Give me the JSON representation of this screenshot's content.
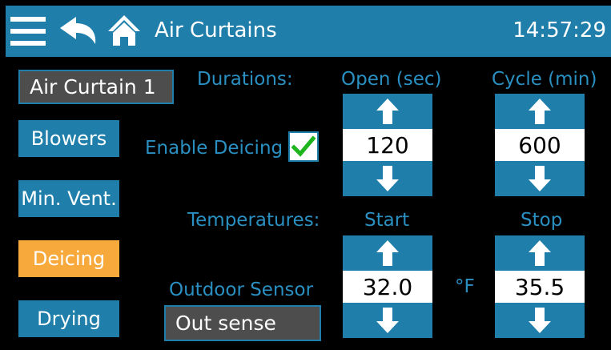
{
  "header": {
    "title": "Air Curtains",
    "time": "14:57:29",
    "icons": [
      "menu-icon",
      "back-arrow-icon",
      "home-icon"
    ]
  },
  "curtain_select": {
    "value": "Air Curtain 1"
  },
  "sidebar": {
    "items": [
      {
        "label": "Blowers",
        "active": false
      },
      {
        "label": "Min. Vent.",
        "active": false
      },
      {
        "label": "Deicing",
        "active": true
      },
      {
        "label": "Drying",
        "active": false
      }
    ]
  },
  "durations": {
    "label": "Durations:",
    "enable_label": "Enable Deicing",
    "enabled": true,
    "open": {
      "header": "Open (sec)",
      "value": "120"
    },
    "cycle": {
      "header": "Cycle (min)",
      "value": "600"
    }
  },
  "temperatures": {
    "label": "Temperatures:",
    "unit": "°F",
    "start": {
      "header": "Start",
      "value": "32.0"
    },
    "stop": {
      "header": "Stop",
      "value": "35.5"
    }
  },
  "sensor": {
    "label": "Outdoor Sensor",
    "value": "Out sense"
  },
  "colors": {
    "accent": "#1f7faa",
    "active": "#f7a93b",
    "label_text": "#2a8fc1",
    "check": "#1db41d"
  }
}
